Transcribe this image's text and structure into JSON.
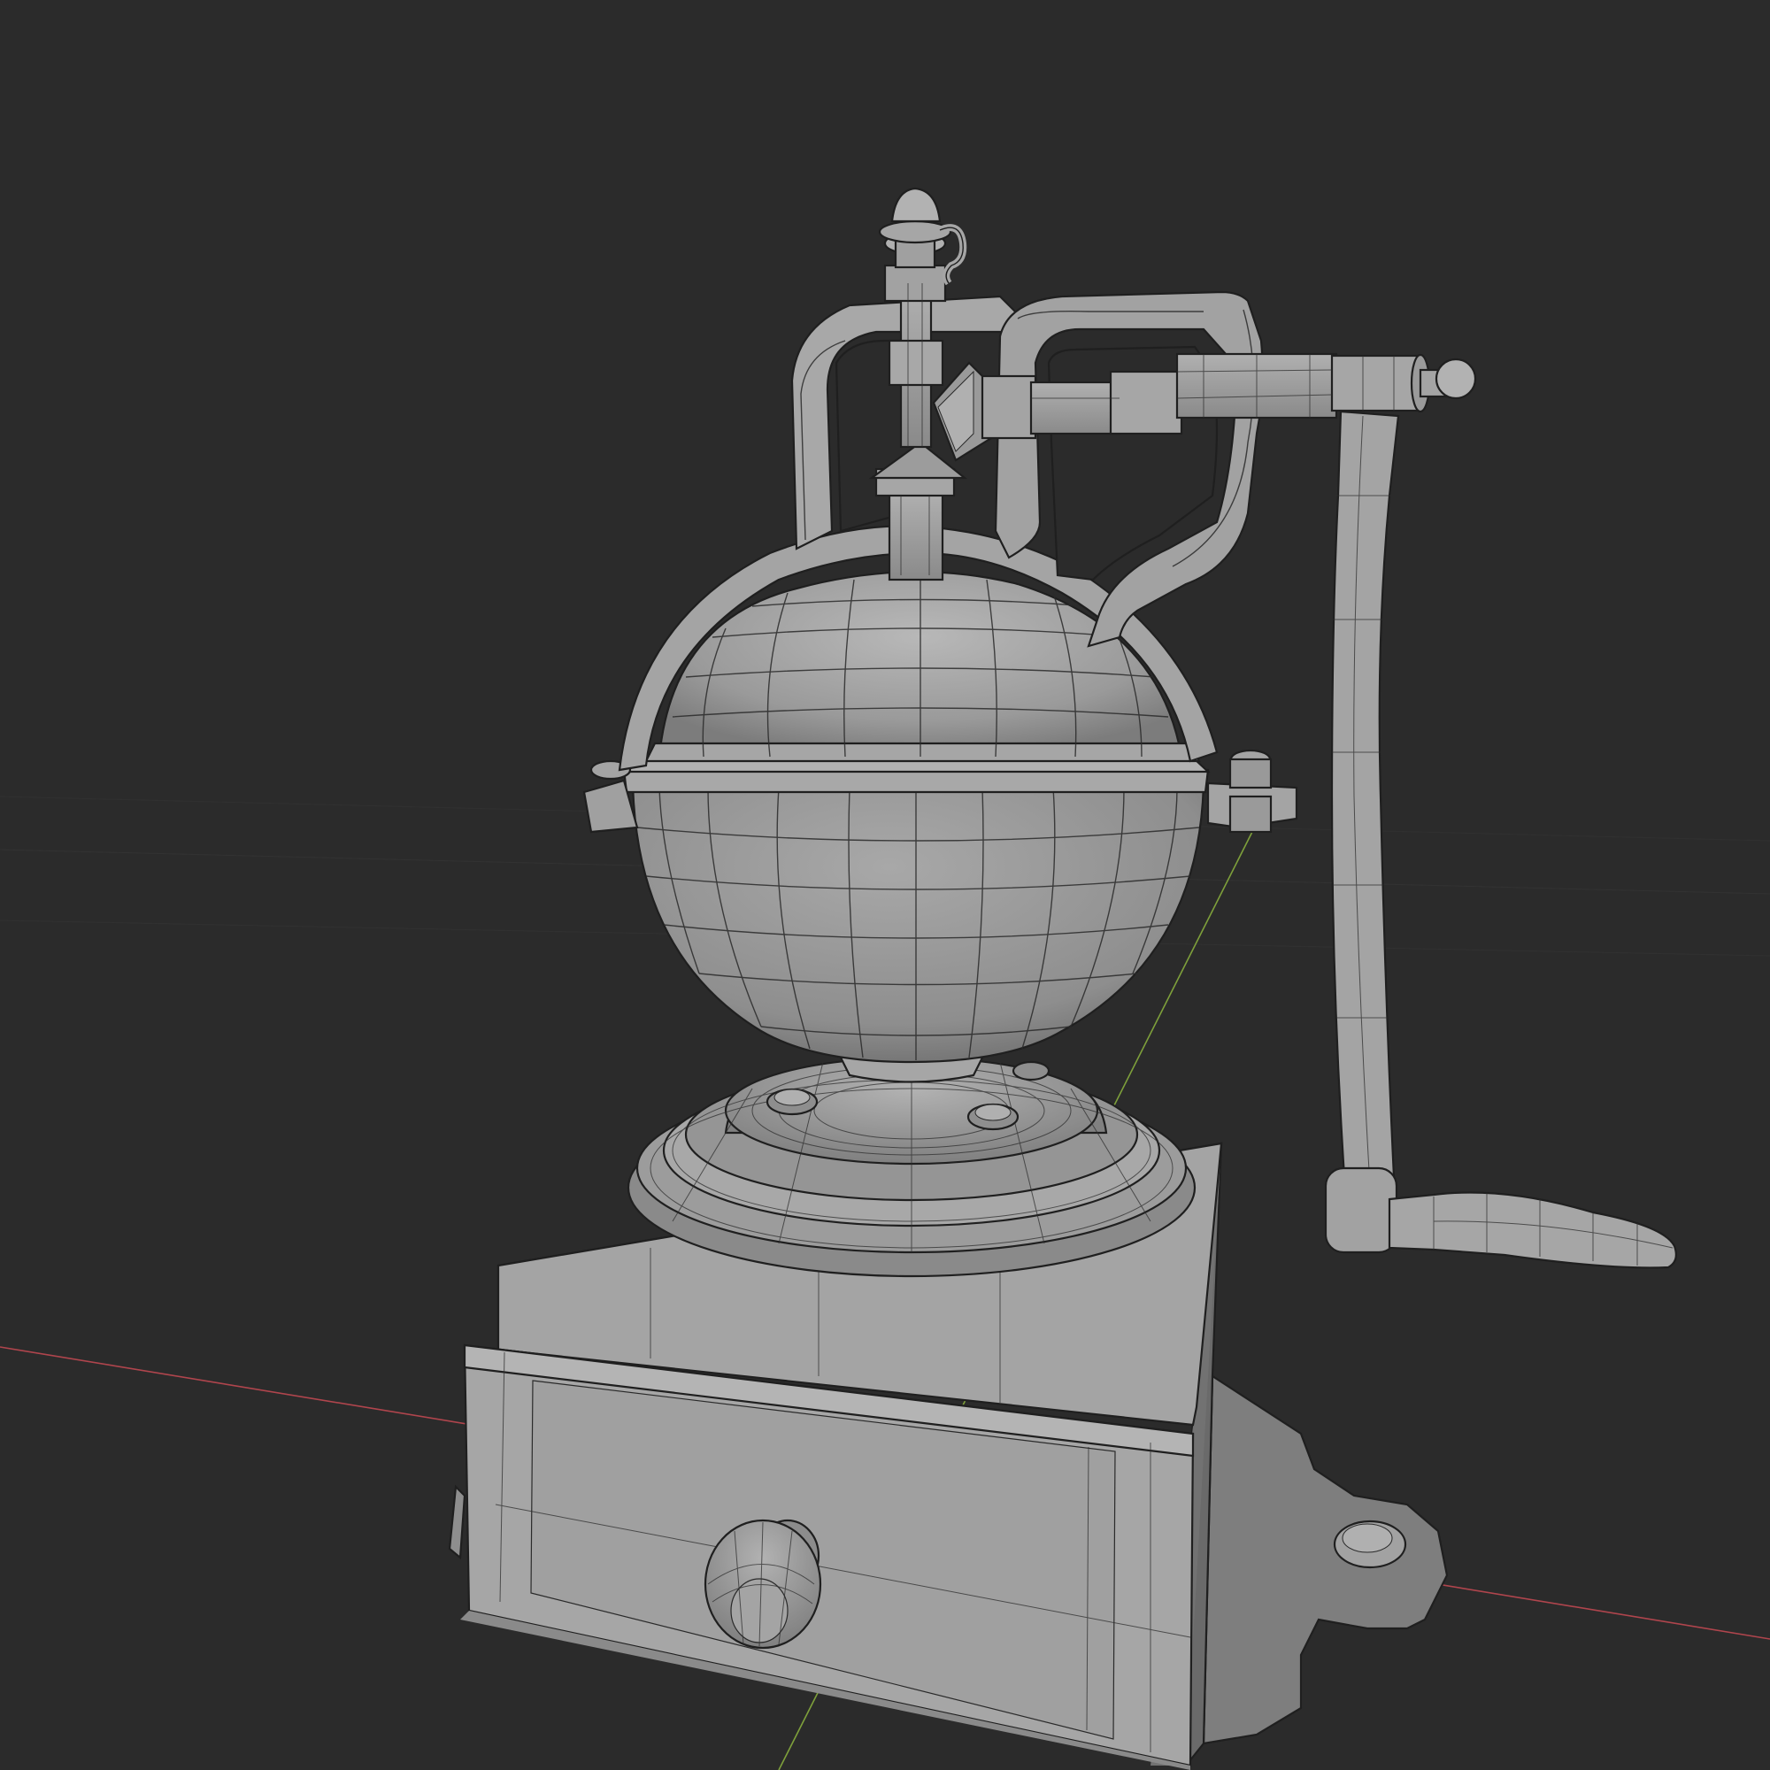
{
  "viewport": {
    "background": "#2b2b2b",
    "mode": "solid-wireframe",
    "axis_colors": {
      "x_axis": "#b0454d",
      "y_axis": "#7ea03b"
    },
    "object": {
      "name_icon": "coffee-grinder-mesh",
      "base_color": "#9a9a9a",
      "wire_color": "#2a2a2a"
    }
  }
}
